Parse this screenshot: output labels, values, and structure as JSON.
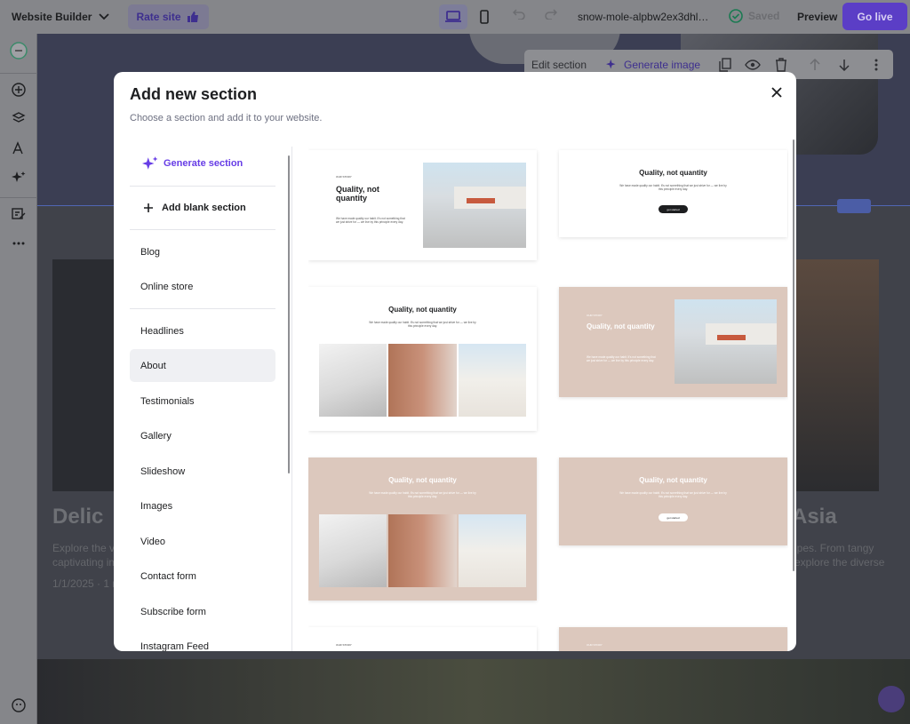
{
  "topbar": {
    "app_title": "Website Builder",
    "rate_label": "Rate site",
    "url": "snow-mole-alpbw2ex3dhl7p...",
    "saved_label": "Saved",
    "preview_label": "Preview",
    "go_live_label": "Go live",
    "device": "desktop"
  },
  "edit_bar": {
    "edit_label": "Edit section",
    "generate_image_label": "Generate image"
  },
  "background": {
    "heading_left": "Delic",
    "heading_right": "Asia",
    "text_left_1": "Explore the vi",
    "text_left_2": "captivating im",
    "meta_left": "1/1/2025 · 1 mi",
    "text_right_1": "ipes. From tangy",
    "text_right_2": "explore the diverse"
  },
  "modal": {
    "title": "Add new section",
    "subtitle": "Choose a section and add it to your website.",
    "generate_label": "Generate section",
    "blank_label": "Add blank section",
    "categories_group1": [
      "Blog",
      "Online store"
    ],
    "categories_group2": [
      "Headlines",
      "About",
      "Testimonials",
      "Gallery",
      "Slideshow",
      "Images",
      "Video",
      "Contact form",
      "Subscribe form",
      "Instagram Feed"
    ],
    "active_category": "About"
  },
  "thumbnails": [
    {
      "eyebrow": "OUR STORY",
      "heading": "Quality, not quantity",
      "body": "We have made quality our habit. It's not something that we just strive for — we live by this principle every day."
    },
    {
      "heading": "Quality, not quantity",
      "body": "We have made quality our habit. It's not something that we just strive for — we live by this principle every day.",
      "button": "get started"
    },
    {
      "heading": "Quality, not quantity",
      "body": "We have made quality our habit. It's not something that we just strive for — we live by this principle every day."
    },
    {
      "eyebrow": "OUR STORY",
      "heading": "Quality, not quantity",
      "body": "We have made quality our habit. It's not something that we just strive for — we live by this principle every day."
    },
    {
      "heading": "Quality, not quantity",
      "body": "We have made quality our habit. It's not something that we just strive for — we live by this principle every day."
    },
    {
      "heading": "Quality, not quantity",
      "body": "We have made quality our habit. It's not something that we just strive for — we live by this principle every day.",
      "button": "get started"
    },
    {
      "eyebrow": "OUR STORY"
    },
    {
      "eyebrow": "OUR STORY"
    }
  ],
  "colors": {
    "accent": "#673de6",
    "go_live": "#5b3ec6",
    "pink": "#dcc8bd"
  }
}
